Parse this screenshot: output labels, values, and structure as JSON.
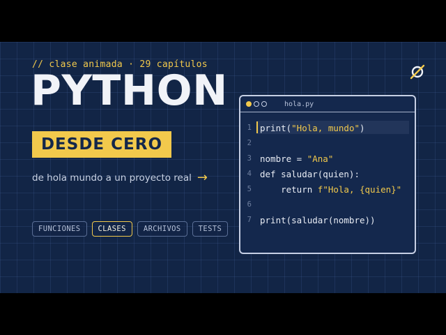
{
  "eyebrow": "// clase animada · 29 capítulos",
  "title": "PYTHON",
  "highlight": "DESDE CERO",
  "tagline": "de hola mundo a un proyecto real",
  "tags": [
    {
      "label": "FUNCIONES",
      "active": false
    },
    {
      "label": "CLASES",
      "active": true
    },
    {
      "label": "ARCHIVOS",
      "active": false
    },
    {
      "label": "TESTS",
      "active": false
    }
  ],
  "editor": {
    "filename": "hola.py",
    "line_numbers": [
      "1",
      "2",
      "3",
      "4",
      "5",
      "6",
      "7"
    ],
    "lines": [
      {
        "a": "print(",
        "b": "\"Hola, mundo\"",
        "c": ")"
      },
      {
        "a": "",
        "b": "",
        "c": ""
      },
      {
        "a": "nombre = ",
        "b": "\"Ana\"",
        "c": ""
      },
      {
        "a": "def saludar(quien):",
        "b": "",
        "c": ""
      },
      {
        "a": "    return ",
        "b": "f\"Hola, {quien}\"",
        "c": ""
      },
      {
        "a": "",
        "b": "",
        "c": ""
      },
      {
        "a": "print(saludar(nombre))",
        "b": "",
        "c": ""
      }
    ]
  },
  "colors": {
    "background": "#122546",
    "accent": "#f2c94c",
    "text": "#f1f3f8"
  },
  "icons": {
    "logo": "slashed-circle-logo",
    "arrow": "right-arrow-icon"
  }
}
